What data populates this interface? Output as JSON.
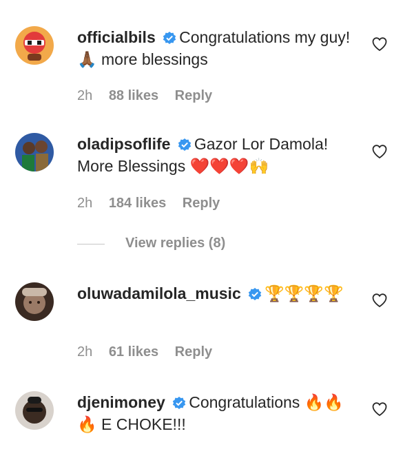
{
  "comments": [
    {
      "username": "officialbils",
      "verified": true,
      "text": "Congratulations my guy! 🙏🏾 more blessings",
      "time": "2h",
      "likes": "88 likes",
      "reply": "Reply"
    },
    {
      "username": "oladipsoflife",
      "verified": true,
      "text": "Gazor Lor Damola! More Blessings ❤️❤️❤️🙌",
      "time": "2h",
      "likes": "184 likes",
      "reply": "Reply",
      "view_replies": "View replies (8)"
    },
    {
      "username": "oluwadamilola_music",
      "verified": true,
      "text": "🏆🏆🏆🏆",
      "time": "2h",
      "likes": "61 likes",
      "reply": "Reply"
    },
    {
      "username": "djenimoney",
      "verified": true,
      "text": "Congratulations 🔥🔥🔥 E CHOKE!!!",
      "time": "",
      "likes": "",
      "reply": ""
    }
  ],
  "colors": {
    "verified_blue": "#3897f0",
    "meta_gray": "#8e8e8e",
    "text": "#262626"
  }
}
